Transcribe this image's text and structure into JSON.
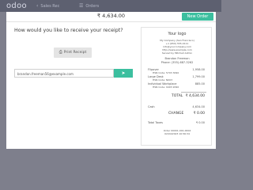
{
  "topbar": {
    "logo": "odoo",
    "left_button": {
      "icon": "chevron-left-icon",
      "label": "Sales Rec"
    },
    "right_button": {
      "icon": "list-icon",
      "label": "Orders"
    }
  },
  "screen": {
    "amount": "₹ 4,634.00",
    "new_order_label": "New Order",
    "question": "How would you like to receive your receipt?",
    "print_label": "Print Receipt",
    "email_value": "brandon.freeman56@example.com",
    "send_icon": "send-icon"
  },
  "receipt": {
    "logo_text": "Your logo",
    "company_lines": [
      "My Company (San Francisco)",
      "+1 (650) 555-0111",
      "info@yourcompany.com",
      "http://www.example.com",
      "Served by Mitchell Admin"
    ],
    "customer_name": "Brandon Freeman",
    "customer_phone": "Phone: (355)-687-3262",
    "items": [
      {
        "name": "Flipover",
        "detail": "HSN Code: 5703 3090",
        "price": "1,958.00"
      },
      {
        "name": "Large Desk",
        "detail": "HSN Code: N003",
        "price": "1,799.00"
      },
      {
        "name": "Individual Workplace",
        "detail": "HSN Code: 9403 2090",
        "price": "885.00"
      }
    ],
    "total_label": "TOTAL",
    "total_value": "₹ 4,634.00",
    "cash_label": "Cash",
    "cash_value": "4,634.00",
    "change_label": "CHANGE",
    "change_value": "₹ 0.00",
    "taxes_label": "Total Taxes",
    "taxes_value": "₹ 0.00",
    "order_ref": "Order 00001-001-0004",
    "order_date": "02/04/2023 10:56:34"
  }
}
